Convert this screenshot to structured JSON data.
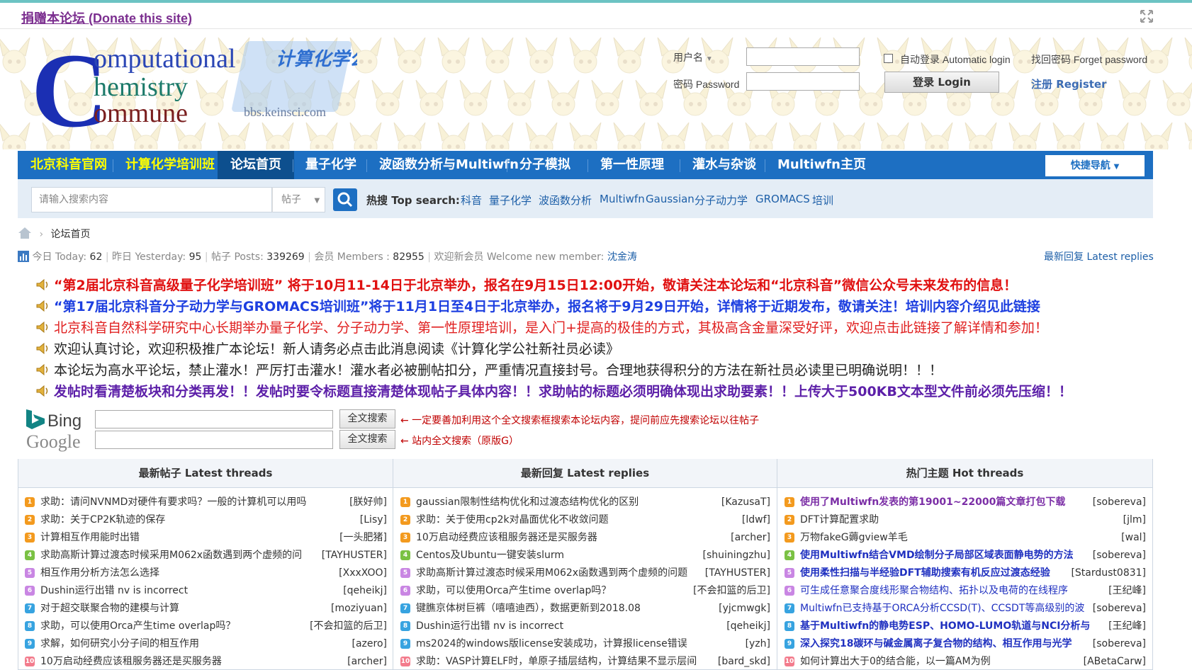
{
  "donate": {
    "label": "捐赠本论坛 (Donate this site)"
  },
  "header": {
    "logo_lines": [
      "omputational",
      "hemistry",
      "ommune"
    ],
    "logo_cn": "计算化学公社",
    "logo_url": "bbs.keinsci.com"
  },
  "login": {
    "username_label": "用户名",
    "password_label": "密码 Password",
    "auto_login": "自动登录 Automatic login",
    "forget": "找回密码 Forget password",
    "login_button": "登录 Login",
    "register": "注册 Register"
  },
  "nav": {
    "items": [
      {
        "label": "北京科音官网",
        "style": "yellow"
      },
      {
        "label": "计算化学培训班",
        "style": "yellow"
      },
      {
        "label": "论坛首页",
        "style": "active"
      },
      {
        "label": "量子化学",
        "style": "normal"
      },
      {
        "label": "波函数分析与Multiwfn",
        "style": "normal"
      },
      {
        "label": "分子模拟",
        "style": "normal"
      },
      {
        "label": "第一性原理",
        "style": "normal"
      },
      {
        "label": "灌水与杂谈",
        "style": "normal"
      },
      {
        "label": "Multiwfn主页",
        "style": "normal"
      }
    ],
    "quick_nav": "快捷导航"
  },
  "search": {
    "placeholder": "请输入搜索内容",
    "type": "帖子",
    "hot_label": "热搜 Top search:",
    "hot_items": [
      "科音",
      "量子化学",
      "波函数分析",
      "Multiwfn",
      "Gaussian",
      "分子动力学",
      "GROMACS",
      "培训"
    ]
  },
  "breadcrumb": {
    "current": "论坛首页"
  },
  "stats": {
    "today_label": "今日 Today:",
    "today": "62",
    "yesterday_label": "昨日 Yesterday:",
    "yesterday": "95",
    "posts_label": "帖子 Posts:",
    "posts": "339269",
    "members_label": "会员 Members :",
    "members": "82955",
    "welcome_label": "欢迎新会员 Welcome new member:",
    "welcome_member": "沈金涛",
    "latest_replies_link": "最新回复 Latest replies"
  },
  "announcements": [
    {
      "text": "“第2届北京科音高级量子化学培训班” 将于10月11-14日于北京举办，报名在9月15日12:00开始，敬请关注本论坛和“北京科音”微信公众号未来发布的信息！",
      "style": "a-red"
    },
    {
      "text": "“第17届北京科音分子动力学与GROMACS培训班”将于11月1日至4日于北京举办，报名将于9月29日开始，详情将于近期发布，敬请关注！培训内容介绍见此链接",
      "style": "a-blue"
    },
    {
      "text": "北京科音自然科学研究中心长期举办量子化学、分子动力学、第一性原理培训，是入门+提高的极佳的方式，其极高含金量深受好评，欢迎点击此链接了解详情和参加！",
      "style": "a-normal"
    },
    {
      "text": "欢迎认真讨论，欢迎积极推广本论坛！新人请务必点击此消息阅读《计算化学公社新社员必读》",
      "style": "a-dark"
    },
    {
      "text": "本论坛为高水平论坛，禁止灌水！严厉打击灌水！灌水者必被删帖扣分，严重情况直接封号。合理地获得积分的方法在新社员必读里已明确说明！！！",
      "style": "a-dark"
    },
    {
      "text": "发帖时看清楚板块和分类再发！！发帖时要令标题直接清楚体现帖子具体内容！！求助帖的标题必须明确体现出求助要素！！上传大于500KB文本型文件前必须先压缩！！",
      "style": "a-purple"
    }
  ],
  "fulltext": {
    "button1": "全文搜索",
    "note1": "← 一定要善加利用这个全文搜索框搜索本论坛内容，提问前应先搜索论坛以往帖子",
    "button2": "全文搜索",
    "note2": "← 站内全文搜索（原版G）",
    "bing": "Bing",
    "google": "Google"
  },
  "columns": {
    "latest_threads": "最新帖子 Latest threads",
    "latest_replies": "最新回复 Latest replies",
    "hot_threads": "热门主题 Hot threads"
  },
  "latest_threads": [
    {
      "title": "求助：请问NVNMD对硬件有要求吗？一般的计算机可以用吗",
      "author": "[朕好帅]"
    },
    {
      "title": "求助：关于CP2K轨迹的保存",
      "author": "[Lisy]"
    },
    {
      "title": "计算相互作用能时出错",
      "author": "[一头肥猪]"
    },
    {
      "title": "求助高斯计算过渡态时候采用M062x函数遇到两个虚频的问",
      "author": "[TAYHUSTER]"
    },
    {
      "title": "相互作用分析方法怎么选择",
      "author": "[XxxXOO]"
    },
    {
      "title": "Dushin运行出错 nv is incorrect",
      "author": "[qeheikj]"
    },
    {
      "title": "对于超交联聚合物的建模与计算",
      "author": "[moziyuan]"
    },
    {
      "title": "求助，可以使用Orca产生time overlap吗？",
      "author": "[不会扣篮的后卫]"
    },
    {
      "title": "求解，如何研究小分子间的相互作用",
      "author": "[azero]"
    },
    {
      "title": "10万启动经费应该租服务器还是买服务器",
      "author": "[archer]"
    }
  ],
  "latest_replies": [
    {
      "title": "gaussian限制性结构优化和过渡态结构优化的区别",
      "author": "[KazusaT]"
    },
    {
      "title": "求助：关于使用cp2k对晶面优化不收敛问题",
      "author": "[ldwf]"
    },
    {
      "title": "10万启动经费应该租服务器还是买服务器",
      "author": "[archer]"
    },
    {
      "title": "Centos及Ubuntu一键安装slurm",
      "author": "[shuiningzhu]"
    },
    {
      "title": "求助高斯计算过渡态时候采用M062x函数遇到两个虚频的问题",
      "author": "[TAYHUSTER]"
    },
    {
      "title": "求助，可以使用Orca产生time overlap吗？",
      "author": "[不会扣篮的后卫]"
    },
    {
      "title": "键膲京体树巨裤（嘻嘻迪西），数据更新到2018.08",
      "author": "[yjcmwgk]"
    },
    {
      "title": "Dushin运行出错 nv is incorrect",
      "author": "[qeheikj]"
    },
    {
      "title": "ms2024的windows版license安装成功，计算报license错误",
      "author": "[yzh]"
    },
    {
      "title": "求助：VASP计算ELF时，单原子插层结构，计算结果不显示层间",
      "author": "[bard_skd]"
    }
  ],
  "hot_threads": [
    {
      "title": "使用了Multiwfn发表的第19001~22000篇文章打包下载",
      "author": "[sobereva]",
      "style": "t-hot-purple"
    },
    {
      "title": "DFT计算配置求助",
      "author": "[jlm]",
      "style": "t-dark"
    },
    {
      "title": "万物fakeG薅gview羊毛",
      "author": "[wal]",
      "style": "t-dark"
    },
    {
      "title": "使用Multiwfn结合VMD绘制分子局部区域表面静电势的方法",
      "author": "[sobereva]",
      "style": "t-hot-bold"
    },
    {
      "title": "使用柔性扫描与半经验DFT辅助搜索有机反应过渡态经验",
      "author": "[Stardust0831]",
      "style": "t-hot-bold"
    },
    {
      "title": "可生成任意聚合度线形聚合物结构、拓扑以及电荷的在线程序",
      "author": "[王纪峰]",
      "style": "t-hot-normal"
    },
    {
      "title": "Multiwfn已支持基于ORCA分析CCSD(T)、CCSDT等高级别的波",
      "author": "[sobereva]",
      "style": "t-hot-normal"
    },
    {
      "title": "基于Multiwfn的静电势ESP、HOMO-LUMO轨道与NCI分析与",
      "author": "[王纪峰]",
      "style": "t-hot-bold"
    },
    {
      "title": "深入探究18碳环与碱金属离子复合物的结构、相互作用与光学",
      "author": "[sobereva]",
      "style": "t-hot-bold"
    },
    {
      "title": "如何计算出大于0的结合能，以一篇AM为例",
      "author": "[ABetaCarw]",
      "style": "t-dark"
    }
  ],
  "rank_colors": [
    "#f39a1e",
    "#f39a1e",
    "#f39a1e",
    "#7ac143",
    "#c986e3",
    "#c986e3",
    "#37a3e0",
    "#37a3e0",
    "#37a3e0",
    "#f37b8c"
  ]
}
